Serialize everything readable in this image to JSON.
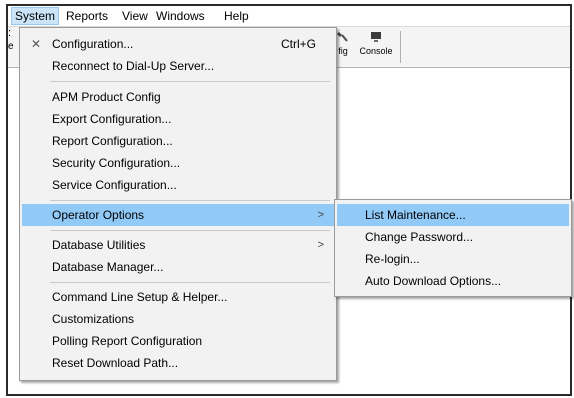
{
  "menubar": {
    "items": [
      {
        "label": "System",
        "active": true
      },
      {
        "label": "Reports"
      },
      {
        "label": "View"
      },
      {
        "label": "Windows"
      },
      {
        "label": "Help"
      }
    ]
  },
  "toolbar": {
    "buttons": [
      {
        "label": "fig",
        "icon": "config-icon"
      },
      {
        "label": "Console",
        "icon": "console-icon"
      }
    ]
  },
  "system_menu": {
    "items": [
      {
        "label": "Configuration...",
        "shortcut": "Ctrl+G",
        "icon": "tools-icon"
      },
      {
        "label": "Reconnect to Dial-Up Server..."
      },
      {
        "separator": true
      },
      {
        "label": "APM Product Config"
      },
      {
        "label": "Export Configuration..."
      },
      {
        "label": "Report Configuration..."
      },
      {
        "label": "Security Configuration..."
      },
      {
        "label": "Service Configuration..."
      },
      {
        "separator": true
      },
      {
        "label": "Operator Options",
        "submenu": true,
        "highlighted": true
      },
      {
        "separator": true
      },
      {
        "label": "Database Utilities",
        "submenu": true
      },
      {
        "label": "Database Manager..."
      },
      {
        "separator": true
      },
      {
        "label": "Command Line Setup & Helper..."
      },
      {
        "label": "Customizations"
      },
      {
        "label": "Polling Report Configuration"
      },
      {
        "label": "Reset Download Path..."
      }
    ]
  },
  "operator_options_submenu": {
    "items": [
      {
        "label": "List Maintenance...",
        "highlighted": true
      },
      {
        "label": "Change Password..."
      },
      {
        "label": "Re-login..."
      },
      {
        "label": "Auto Download Options..."
      }
    ]
  },
  "colors": {
    "highlight": "#91c9f7",
    "menubar_active": "#cce4f7",
    "menu_background": "#f2f2f2"
  }
}
